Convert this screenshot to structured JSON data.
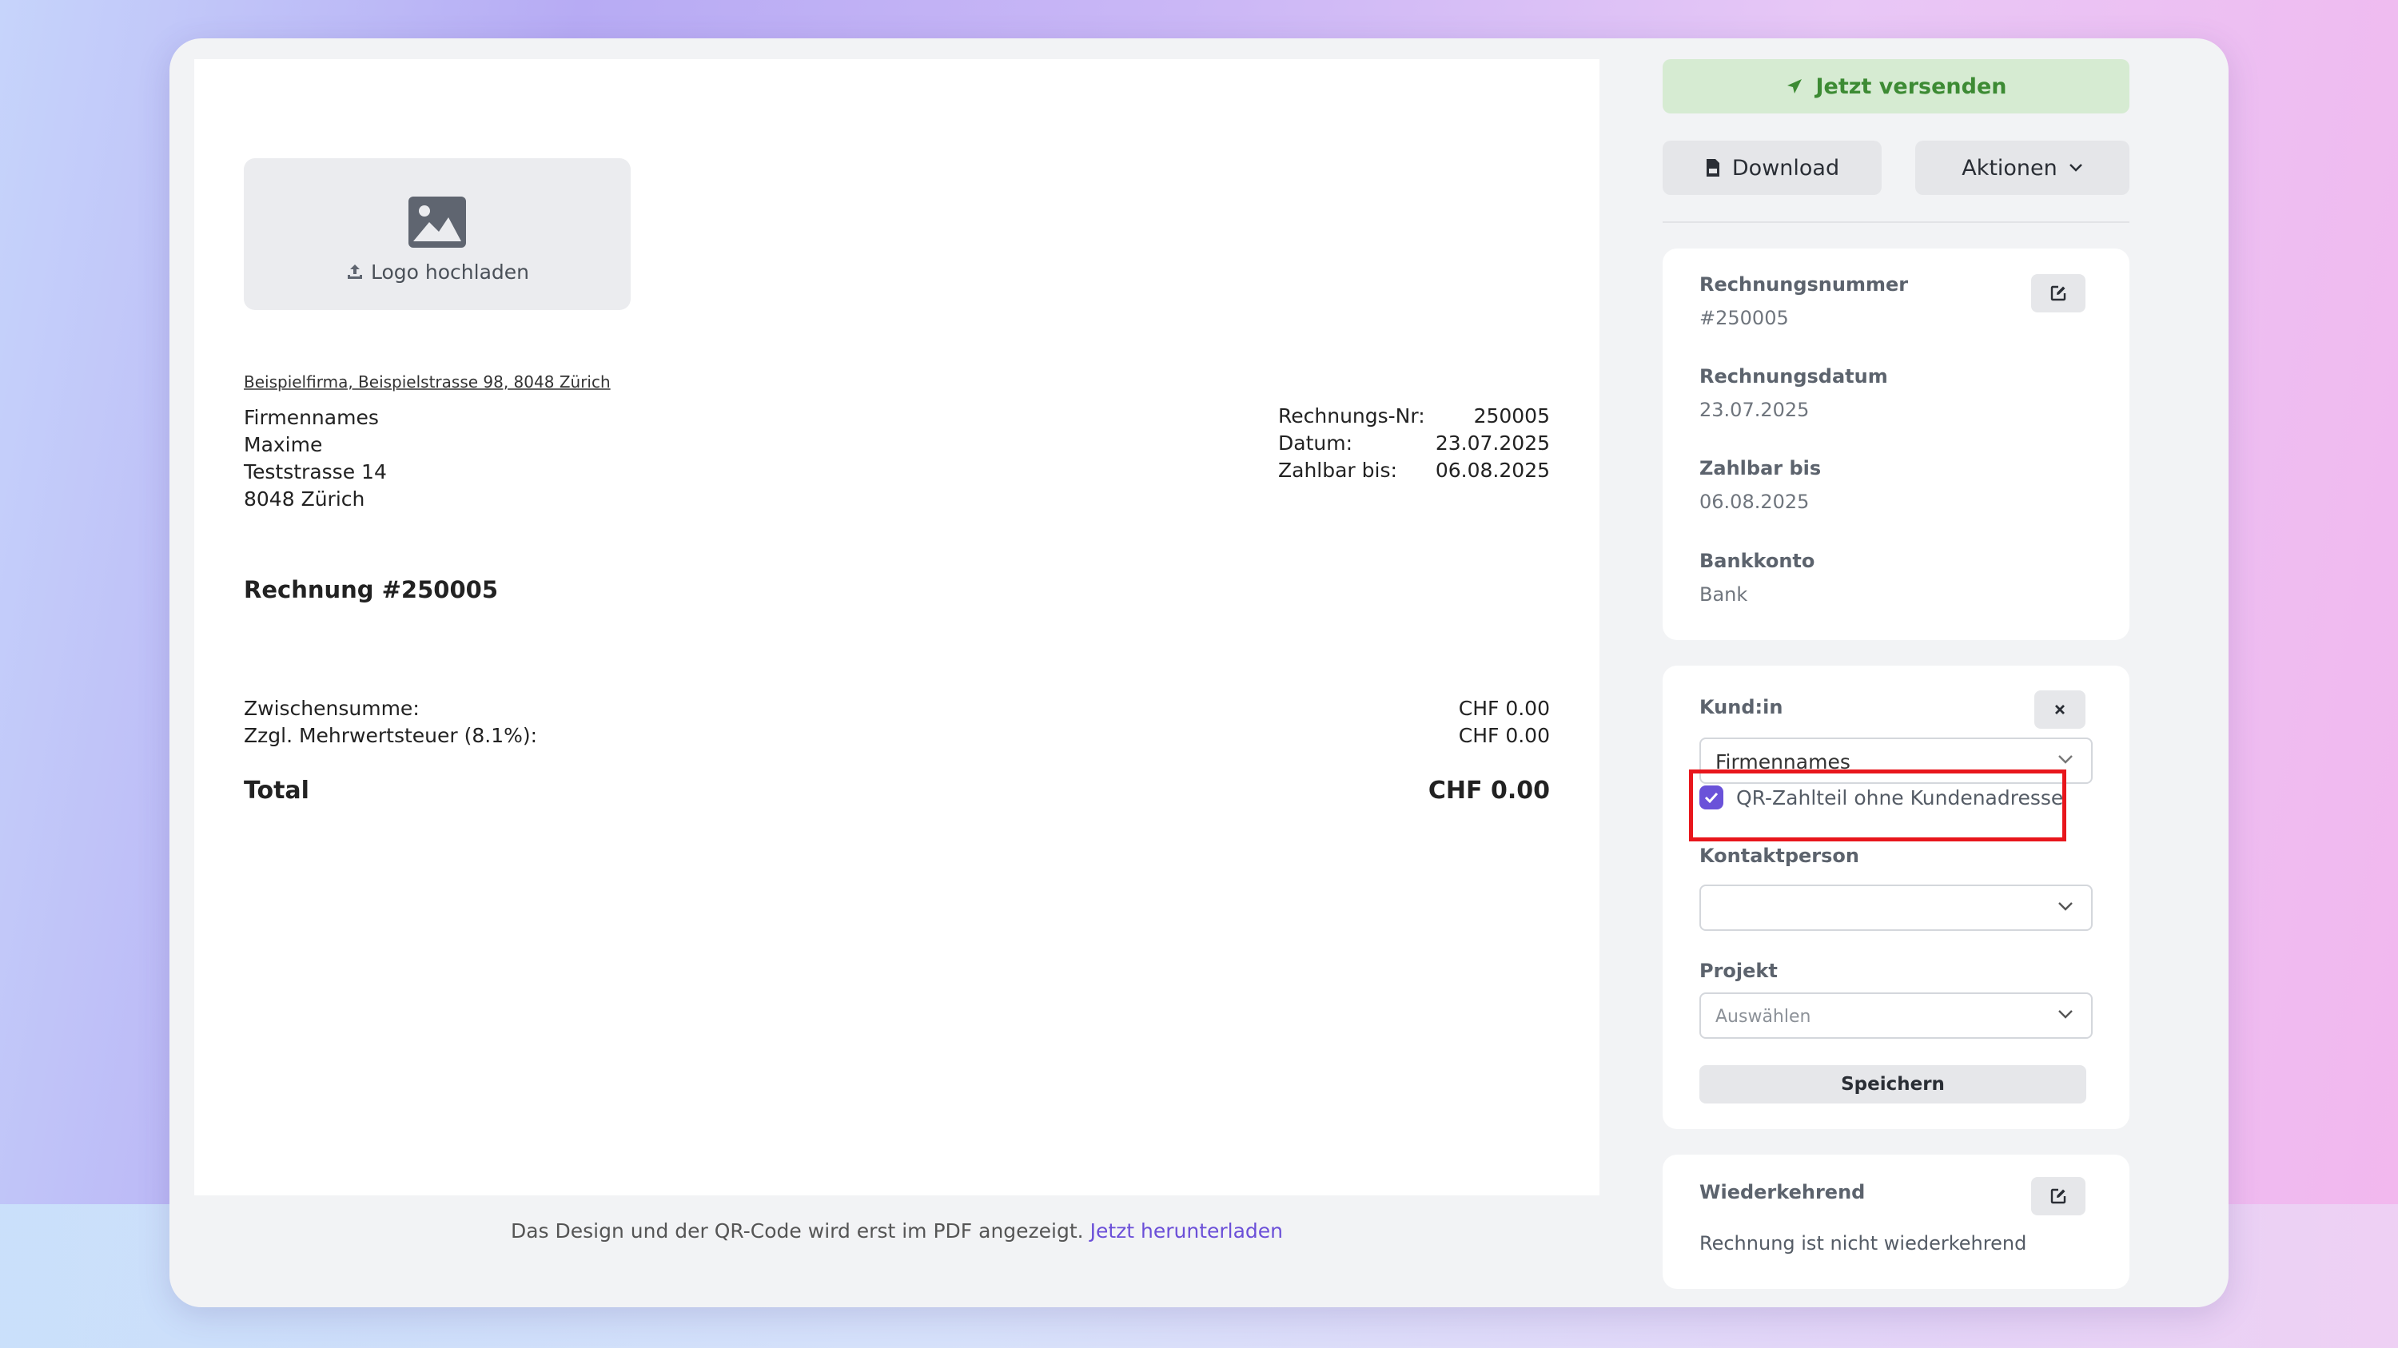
{
  "invoice": {
    "logo_upload_label": "Logo hochladen",
    "sender_line": "Beispielfirma, Beispielstrasse 98, 8048 Zürich",
    "recipient": [
      "Firmennames",
      "Maxime",
      "Teststrasse 14",
      "8048 Zürich"
    ],
    "meta": [
      {
        "label": "Rechnungs-Nr:",
        "value": "250005"
      },
      {
        "label": "Datum:",
        "value": "23.07.2025"
      },
      {
        "label": "Zahlbar bis:",
        "value": "06.08.2025"
      }
    ],
    "title": "Rechnung #250005",
    "subtotal_label": "Zwischensumme:",
    "subtotal_value": "CHF 0.00",
    "vat_label": "Zzgl. Mehrwertsteuer (8.1%):",
    "vat_value": "CHF 0.00",
    "total_label": "Total",
    "total_value": "CHF 0.00"
  },
  "footer": {
    "note": "Das Design und der QR-Code wird erst im PDF angezeigt. ",
    "link": "Jetzt herunterladen"
  },
  "actions": {
    "send": "Jetzt versenden",
    "download": "Download",
    "more": "Aktionen"
  },
  "details": {
    "invoice_number_label": "Rechnungsnummer",
    "invoice_number": "#250005",
    "invoice_date_label": "Rechnungsdatum",
    "invoice_date": "23.07.2025",
    "due_label": "Zahlbar bis",
    "due": "06.08.2025",
    "bank_label": "Bankkonto",
    "bank": "Bank"
  },
  "customer": {
    "label": "Kund:in",
    "selected": "Firmennames",
    "qr_checkbox_label": "QR-Zahlteil ohne Kundenadresse",
    "qr_checked": true,
    "contact_label": "Kontaktperson",
    "contact_value": "",
    "project_label": "Projekt",
    "project_placeholder": "Auswählen",
    "save": "Speichern"
  },
  "recurring": {
    "label": "Wiederkehrend",
    "status": "Rechnung ist nicht wiederkehrend"
  },
  "colors": {
    "accent": "#6a52d9",
    "send_bg": "#d6ebd2",
    "send_text": "#3d8b34",
    "highlight": "#e8161c"
  },
  "icons": [
    "image-icon",
    "upload-icon",
    "send-icon",
    "pdf-icon",
    "chevron-down-icon",
    "edit-icon",
    "close-icon",
    "check-icon"
  ]
}
